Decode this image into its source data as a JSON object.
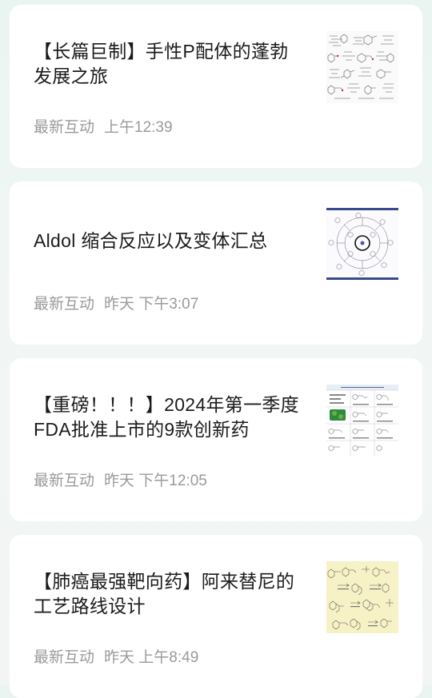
{
  "articles": [
    {
      "title": "【长篇巨制】手性P配体的蓬勃发展之旅",
      "tag": "最新互动",
      "time": "上午12:39",
      "thumbnail": "chemical-structures-thumbnail"
    },
    {
      "title": "Aldol 缩合反应以及变体汇总",
      "tag": "最新互动",
      "time": "昨天 下午3:07",
      "thumbnail": "reaction-wheel-thumbnail"
    },
    {
      "title": "【重磅！！！】2024年第一季度FDA批准上市的9款创新药",
      "tag": "最新互动",
      "time": "昨天 下午12:05",
      "thumbnail": "fda-drug-table-thumbnail"
    },
    {
      "title": "【肺癌最强靶向药】阿来替尼的工艺路线设计",
      "tag": "最新互动",
      "time": "昨天 上午8:49",
      "thumbnail": "synthesis-route-thumbnail"
    }
  ],
  "colors": {
    "background": "#eef6f3",
    "card": "#ffffff",
    "title": "#1b1b1b",
    "meta": "#9a9a9a"
  }
}
